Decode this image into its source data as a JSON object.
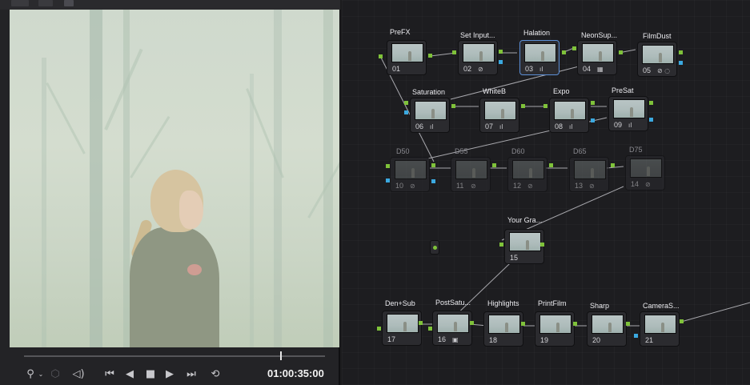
{
  "viewer": {
    "timecode": "01:00:35:00",
    "playhead_fraction": 0.85
  },
  "transport": {
    "eyedropper_icon": "eyedropper-icon",
    "volume_icon": "speaker-icon",
    "buttons": [
      "skip-back-icon",
      "rewind-icon",
      "stop-icon",
      "play-icon",
      "skip-forward-icon",
      "loop-icon"
    ]
  },
  "nodes": [
    {
      "id": "01",
      "label": "PreFX"
    },
    {
      "id": "02",
      "label": "Set Input...",
      "icon": "⊘"
    },
    {
      "id": "03",
      "label": "Halation",
      "icon": "ıl"
    },
    {
      "id": "04",
      "label": "NeonSup...",
      "icon": "▦"
    },
    {
      "id": "05",
      "label": "FilmDust",
      "icon": "⊘ ◌"
    },
    {
      "id": "06",
      "label": "Saturation",
      "icon": "ıl"
    },
    {
      "id": "07",
      "label": "WhiteB",
      "icon": "ıl"
    },
    {
      "id": "08",
      "label": "Expo",
      "icon": "ıl"
    },
    {
      "id": "09",
      "label": "PreSat",
      "icon": "ıl"
    },
    {
      "id": "10",
      "label": "D50",
      "icon": "⊘"
    },
    {
      "id": "11",
      "label": "D55",
      "icon": "⊘"
    },
    {
      "id": "12",
      "label": "D60",
      "icon": "⊘"
    },
    {
      "id": "13",
      "label": "D65",
      "icon": "⊘"
    },
    {
      "id": "14",
      "label": "D75",
      "icon": "⊘"
    },
    {
      "id": "15",
      "label": "Your Gra..."
    },
    {
      "id": "17",
      "label": "Den+Sub"
    },
    {
      "id": "16",
      "label": "PostSatu...",
      "icon": "▣"
    },
    {
      "id": "18",
      "label": "Highlights"
    },
    {
      "id": "19",
      "label": "PrintFilm"
    },
    {
      "id": "20",
      "label": "Sharp"
    },
    {
      "id": "21",
      "label": "CameraS..."
    }
  ],
  "colors": {
    "rgb_port": "#7fc23a",
    "alpha_port": "#3ba9e0",
    "active_node_border": "#5c8fd6"
  }
}
